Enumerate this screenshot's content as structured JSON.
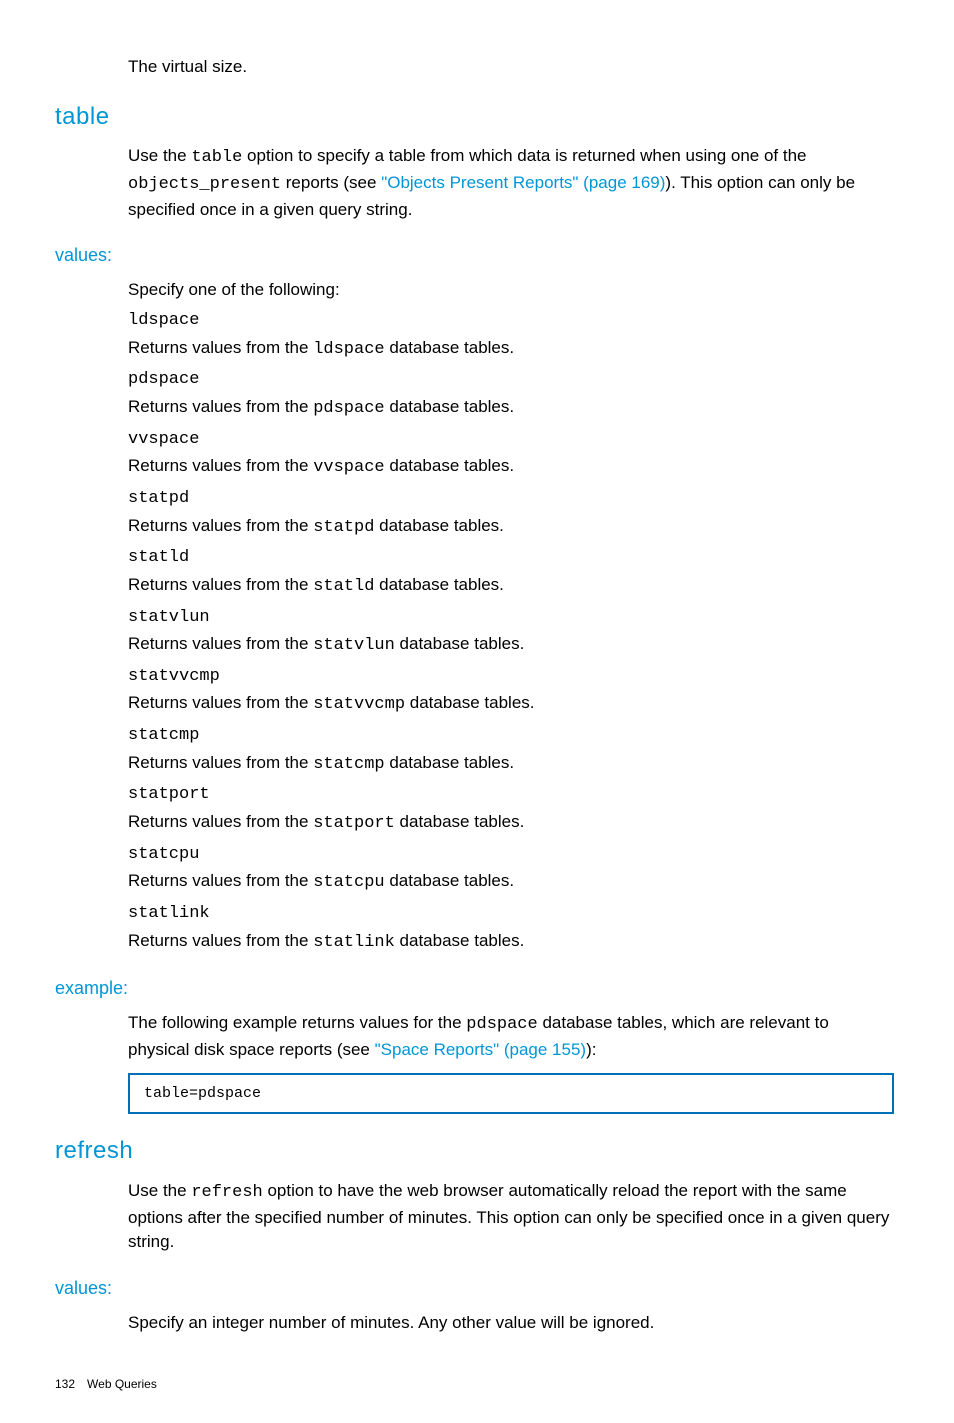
{
  "intro": {
    "vsize": "The virtual size."
  },
  "table_section": {
    "heading": "table",
    "desc_pre": "Use the ",
    "desc_code1": "table",
    "desc_mid1": " option to specify a table from which data is returned when using one of the ",
    "desc_code2": "objects_present",
    "desc_mid2": " reports (see ",
    "desc_link": "\"Objects Present Reports\" (page 169)",
    "desc_post": "). This option can only be specified once in a given query string.",
    "values_heading": "values:",
    "values_intro": "Specify one of the following:",
    "items": [
      {
        "term": "ldspace",
        "dd_pre": "Returns values from the ",
        "dd_code": "ldspace",
        "dd_post": " database tables."
      },
      {
        "term": "pdspace",
        "dd_pre": "Returns values from the ",
        "dd_code": "pdspace",
        "dd_post": " database tables."
      },
      {
        "term": "vvspace",
        "dd_pre": "Returns values from the ",
        "dd_code": "vvspace",
        "dd_post": " database tables."
      },
      {
        "term": "statpd",
        "dd_pre": "Returns values from the ",
        "dd_code": "statpd",
        "dd_post": " database tables."
      },
      {
        "term": "statld",
        "dd_pre": "Returns values from the ",
        "dd_code": "statld",
        "dd_post": " database tables."
      },
      {
        "term": "statvlun",
        "dd_pre": "Returns values from the ",
        "dd_code": "statvlun",
        "dd_post": " database tables."
      },
      {
        "term": "statvvcmp",
        "dd_pre": "Returns values from the ",
        "dd_code": "statvvcmp",
        "dd_post": " database tables."
      },
      {
        "term": "statcmp",
        "dd_pre": "Returns values from the ",
        "dd_code": "statcmp",
        "dd_post": " database tables."
      },
      {
        "term": "statport",
        "dd_pre": "Returns values from the ",
        "dd_code": "statport",
        "dd_post": " database tables."
      },
      {
        "term": "statcpu",
        "dd_pre": "Returns values from the ",
        "dd_code": "statcpu",
        "dd_post": " database tables."
      },
      {
        "term": "statlink",
        "dd_pre": "Returns values from the ",
        "dd_code": "statlink",
        "dd_post": " database tables."
      }
    ],
    "example_heading": "example:",
    "example_pre": "The following example returns values for the ",
    "example_code": "pdspace",
    "example_mid": " database tables, which are relevant to physical disk space reports (see ",
    "example_link": "\"Space Reports\" (page 155)",
    "example_post": "):",
    "example_box": "table=pdspace"
  },
  "refresh_section": {
    "heading": "refresh",
    "desc_pre": "Use the ",
    "desc_code": "refresh",
    "desc_post": " option to have the web browser automatically reload the report with the same options after the specified number of minutes. This option can only be specified once in a given query string.",
    "values_heading": "values:",
    "values_text": "Specify an integer number of minutes. Any other value will be ignored."
  },
  "footer": {
    "page": "132",
    "title": "Web Queries"
  }
}
